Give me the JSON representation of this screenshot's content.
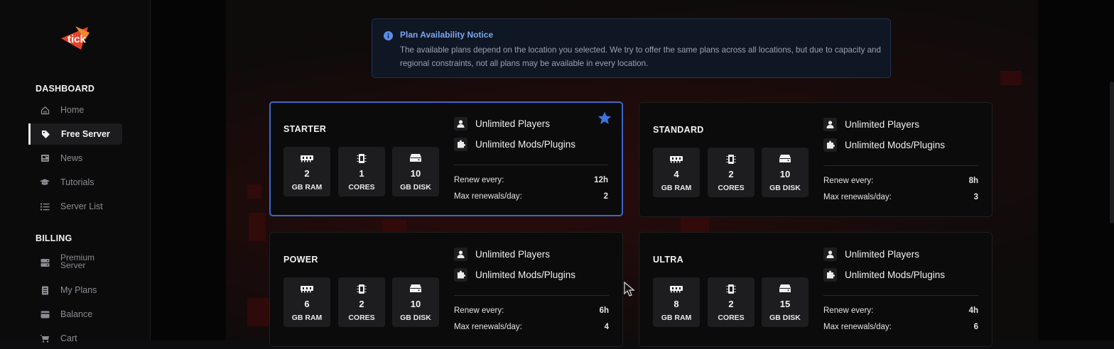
{
  "sidebar": {
    "logo_text": "tick",
    "sections": {
      "dashboard": "DASHBOARD",
      "billing": "BILLING"
    },
    "items": [
      {
        "label": "Home",
        "icon": "home-icon"
      },
      {
        "label": "Free Server",
        "icon": "tag-icon",
        "active": true
      },
      {
        "label": "News",
        "icon": "newspaper-icon"
      },
      {
        "label": "Tutorials",
        "icon": "graduation-cap-icon"
      },
      {
        "label": "Server List",
        "icon": "list-icon"
      },
      {
        "label": "Premium Server",
        "icon": "server-icon"
      },
      {
        "label": "My Plans",
        "icon": "document-icon"
      },
      {
        "label": "Balance",
        "icon": "wallet-icon"
      },
      {
        "label": "Cart",
        "icon": "cart-icon"
      }
    ]
  },
  "notice": {
    "title": "Plan Availability Notice",
    "body": "The available plans depend on the location you selected. We try to offer the same plans across all locations, but due to capacity and regional constraints, not all plans may be available in every location."
  },
  "plans": [
    {
      "name": "STARTER",
      "ram": "2",
      "cores": "1",
      "disk": "10",
      "renew": "12h",
      "max": "2",
      "selected": true
    },
    {
      "name": "STANDARD",
      "ram": "4",
      "cores": "2",
      "disk": "10",
      "renew": "8h",
      "max": "3"
    },
    {
      "name": "POWER",
      "ram": "6",
      "cores": "2",
      "disk": "10",
      "renew": "6h",
      "max": "4"
    },
    {
      "name": "ULTRA",
      "ram": "8",
      "cores": "2",
      "disk": "15",
      "renew": "4h",
      "max": "6"
    }
  ],
  "labels": {
    "ram": "GB RAM",
    "cores": "CORES",
    "disk": "GB DISK",
    "players": "Unlimited Players",
    "mods": "Unlimited Mods/Plugins",
    "renew": "Renew every:",
    "max": "Max renewals/day:"
  },
  "colors": {
    "accent": "#3c67c9",
    "notice_title": "#7aa7ef",
    "star": "#3b76e0"
  }
}
